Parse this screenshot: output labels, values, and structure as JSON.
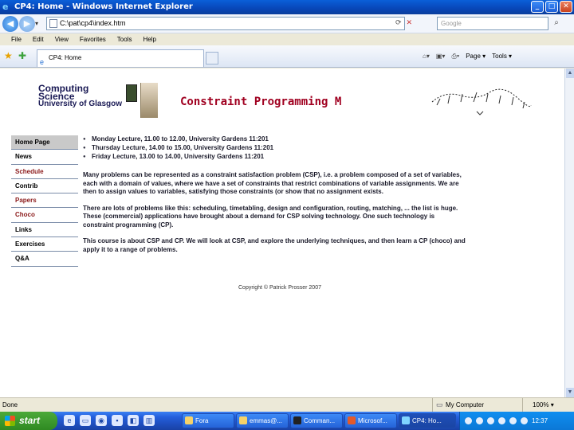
{
  "window": {
    "title": "CP4: Home - Windows Internet Explorer",
    "buttons": [
      "_",
      "□",
      "✕"
    ]
  },
  "address_bar": {
    "url": "C:\\pat\\cp4\\index.htm",
    "search_placeholder": "Google"
  },
  "menu": [
    "File",
    "Edit",
    "View",
    "Favorites",
    "Tools",
    "Help"
  ],
  "tab": {
    "label": "CP4: Home"
  },
  "toolbar_right": {
    "page_label": "Page",
    "tools_label": "Tools"
  },
  "page": {
    "logo_line1": "Computing",
    "logo_line2": "Science",
    "logo_line3": "University of Glasgow",
    "heading": "Constraint Programming M",
    "nav": [
      "Home Page",
      "News",
      "Schedule",
      "Contrib",
      "Papers",
      "Choco",
      "Links",
      "Exercises",
      "Q&A"
    ],
    "lectures": [
      "Monday Lecture, 11.00 to 12.00, University Gardens 11:201",
      "Thursday Lecture, 14.00 to 15.00, University Gardens 11:201",
      "Friday Lecture, 13.00 to 14.00, University Gardens 11:201"
    ],
    "para1": "Many problems can be represented as a constraint satisfaction problem (CSP), i.e. a problem composed of a set of variables, each with a domain of values, where we have a set of constraints that restrict combinations of variable assignments. We are then to assign values to variables, satisfying those constraints (or show that no assignment exists.",
    "para2": "There are lots of problems like this: scheduling, timetabling, design and configuration, routing, matching, ... the list is huge. These (commercial) applications have brought about a demand for CSP solving technology. One such technology is constraint programming (CP).",
    "para3": "This course is about CSP and CP. We will look at CSP, and explore the underlying techniques, and then learn a CP (choco) and apply it to a range of problems.",
    "copyright": "Copyright © Patrick Prosser 2007"
  },
  "status": {
    "text": "Done",
    "zone": "My Computer",
    "zoom": "100%"
  },
  "taskbar": {
    "start_label": "start",
    "tasks": [
      "Fora",
      "emmas@...",
      "Comman...",
      "Microsof...",
      "CP4: Ho..."
    ],
    "clock": "12:37"
  }
}
